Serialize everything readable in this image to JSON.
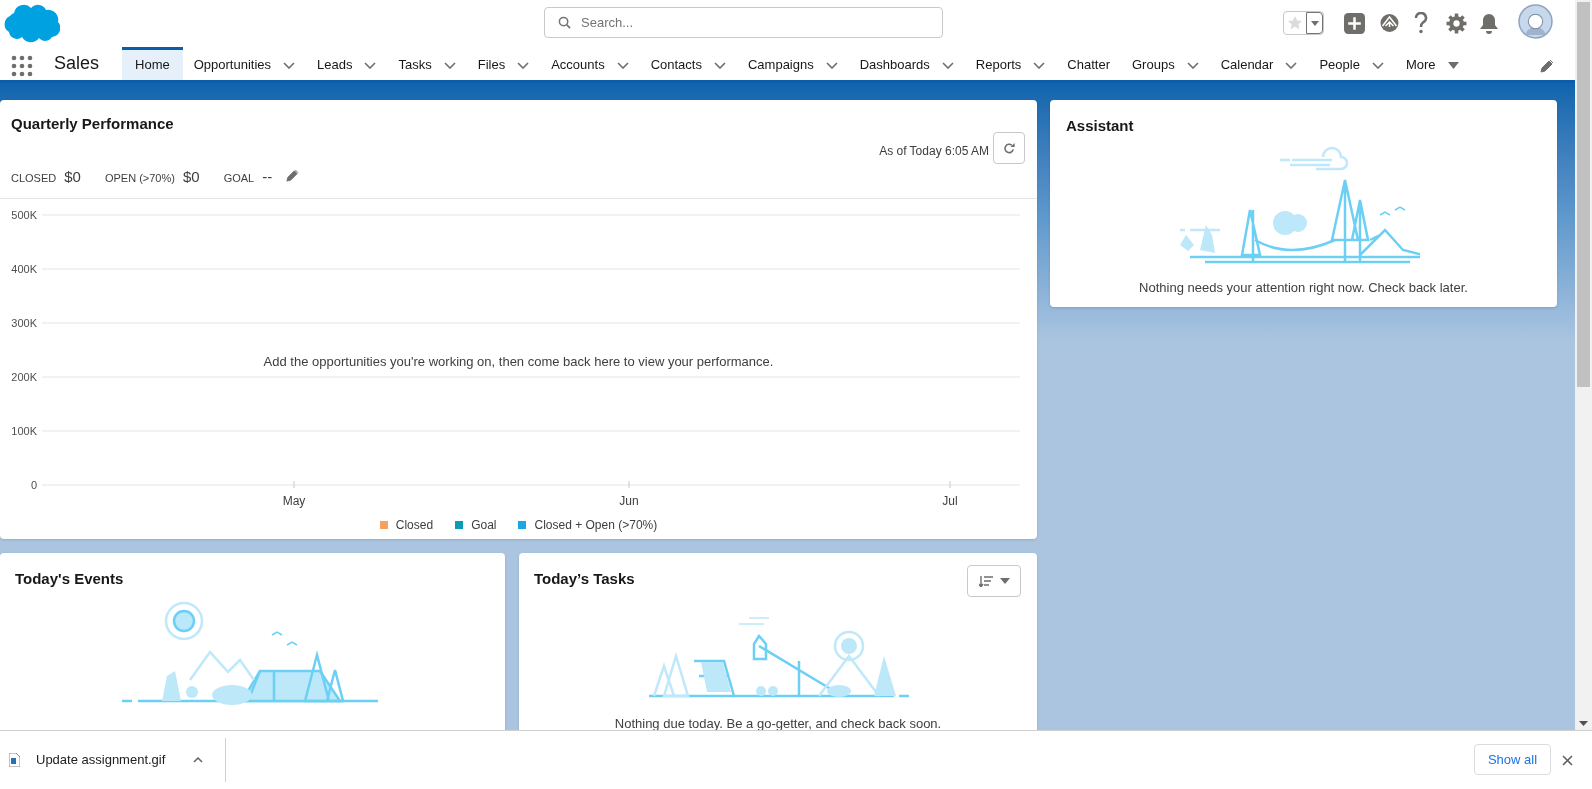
{
  "header": {
    "search": {
      "placeholder": "Search..."
    }
  },
  "nav": {
    "app_name": "Sales",
    "tabs": [
      {
        "label": "Home",
        "selected": true,
        "kind": "plain"
      },
      {
        "label": "Opportunities",
        "selected": false,
        "kind": "chevron"
      },
      {
        "label": "Leads",
        "selected": false,
        "kind": "chevron"
      },
      {
        "label": "Tasks",
        "selected": false,
        "kind": "chevron"
      },
      {
        "label": "Files",
        "selected": false,
        "kind": "chevron"
      },
      {
        "label": "Accounts",
        "selected": false,
        "kind": "chevron"
      },
      {
        "label": "Contacts",
        "selected": false,
        "kind": "chevron"
      },
      {
        "label": "Campaigns",
        "selected": false,
        "kind": "chevron"
      },
      {
        "label": "Dashboards",
        "selected": false,
        "kind": "chevron"
      },
      {
        "label": "Reports",
        "selected": false,
        "kind": "chevron"
      },
      {
        "label": "Chatter",
        "selected": false,
        "kind": "plain"
      },
      {
        "label": "Groups",
        "selected": false,
        "kind": "chevron"
      },
      {
        "label": "Calendar",
        "selected": false,
        "kind": "chevron"
      },
      {
        "label": "People",
        "selected": false,
        "kind": "chevron"
      },
      {
        "label": "More",
        "selected": false,
        "kind": "triangle"
      }
    ]
  },
  "quarterly_performance": {
    "title": "Quarterly Performance",
    "as_of": "As of Today 6:05 AM",
    "metrics": [
      {
        "label": "CLOSED",
        "value": "$0"
      },
      {
        "label": "OPEN (>70%)",
        "value": "$0"
      },
      {
        "label": "GOAL",
        "value": "--"
      }
    ],
    "empty_message": "Add the opportunities you're working on, then come back here to view your performance.",
    "chart_data": {
      "type": "line",
      "grid": true,
      "categories": [
        "May",
        "Jun",
        "Jul"
      ],
      "ylim": [
        0,
        500000
      ],
      "yticks": [
        {
          "value": 0,
          "label": "0"
        },
        {
          "value": 100000,
          "label": "100K"
        },
        {
          "value": 200000,
          "label": "200K"
        },
        {
          "value": 300000,
          "label": "300K"
        },
        {
          "value": 400000,
          "label": "400K"
        },
        {
          "value": 500000,
          "label": "500K"
        }
      ],
      "series": [
        {
          "name": "Closed",
          "color": "#f4a25c",
          "values": [
            null,
            null,
            null
          ]
        },
        {
          "name": "Goal",
          "color": "#0b9cb4",
          "values": [
            null,
            null,
            null
          ]
        },
        {
          "name": "Closed + Open (>70%)",
          "color": "#1ba6e4",
          "values": [
            null,
            null,
            null
          ]
        }
      ]
    }
  },
  "assistant": {
    "title": "Assistant",
    "message": "Nothing needs your attention right now. Check back later."
  },
  "todays_events": {
    "title": "Today's Events"
  },
  "todays_tasks": {
    "title": "Today’s Tasks",
    "message": "Nothing due today. Be a go-getter, and check back soon."
  },
  "downloads": {
    "file": "Update assignment.gif",
    "show_all": "Show all"
  }
}
